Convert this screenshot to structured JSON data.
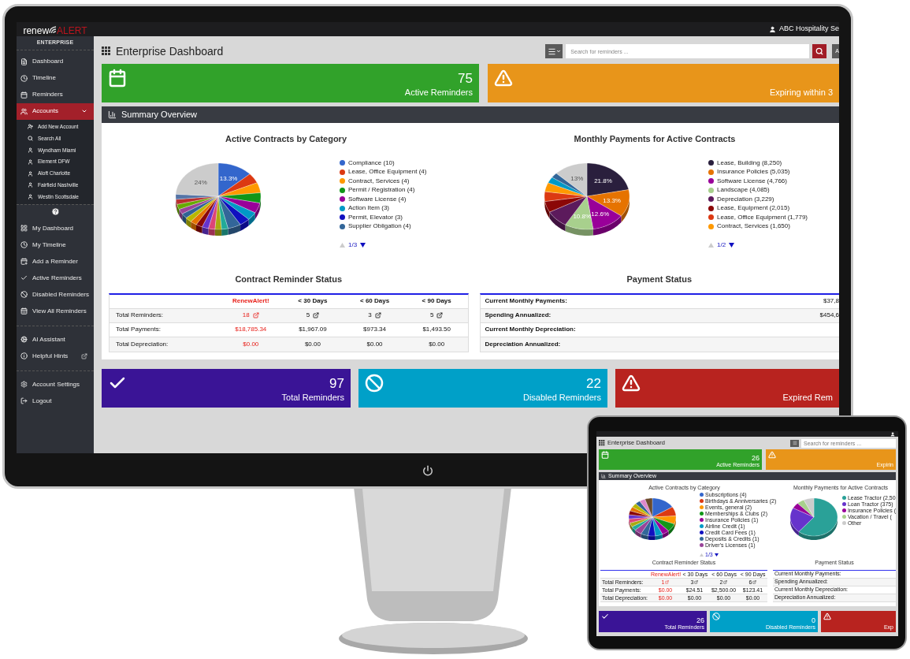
{
  "monitor": {
    "top_bar": {
      "logo_first": "renew",
      "logo_second": "ALERT",
      "account": "ABC Hospitality Se"
    },
    "sidebar": {
      "edition": "ENTERPRISE",
      "sections": [
        {
          "items": [
            {
              "label": "Dashboard",
              "selected": false,
              "expanded": false
            },
            {
              "label": "Timeline",
              "selected": false,
              "expanded": false
            },
            {
              "label": "Reminders",
              "selected": false,
              "expanded": false
            },
            {
              "label": "Accounts",
              "selected": true,
              "expanded": true,
              "children": [
                {
                  "label": "Add New Account"
                },
                {
                  "label": "Search All"
                },
                {
                  "label": "Wyndham Miami"
                },
                {
                  "label": "Element DFW"
                },
                {
                  "label": "Aloft Charlotte"
                },
                {
                  "label": "Fairfield Nashville"
                },
                {
                  "label": "Westin Scottsdale"
                }
              ]
            }
          ]
        },
        {
          "items": [
            {
              "label": "My Dashboard",
              "selected": false
            },
            {
              "label": "My Timeline",
              "selected": false
            },
            {
              "label": "Add a Reminder",
              "selected": false
            },
            {
              "label": "Active Reminders",
              "selected": false
            },
            {
              "label": "Disabled Reminders",
              "selected": false
            },
            {
              "label": "View All Reminders",
              "selected": false
            }
          ]
        },
        {
          "items": [
            {
              "label": "AI Assistant",
              "selected": false
            },
            {
              "label": "Helpful Hints",
              "selected": false
            }
          ]
        },
        {
          "items": [
            {
              "label": "Account Settings",
              "selected": false
            },
            {
              "label": "Logout",
              "selected": false
            }
          ]
        }
      ]
    },
    "dashboard": {
      "title": "Enterprise Dashboard",
      "search": {
        "placeholder": "Search for reminders ...",
        "button_visible": true
      },
      "extra_button": "A",
      "top_cards": [
        {
          "value": "75",
          "label": "Active Reminders",
          "color": "#31a22a"
        },
        {
          "label": "Expiring within 3",
          "color": "#e8951a"
        }
      ],
      "summary": {
        "title": "Summary Overview",
        "charts": [
          {
            "title": "Active Contracts by Category",
            "slice_labels": [
              "13.3%",
              "24%"
            ],
            "pager": "1/3",
            "legend": [
              {
                "label": "Compliance (10)",
                "color": "#3366cc"
              },
              {
                "label": "Lease, Office Equipment (4)",
                "color": "#dc3912"
              },
              {
                "label": "Contract, Services (4)",
                "color": "#ff9900"
              },
              {
                "label": "Permit / Registration (4)",
                "color": "#109618"
              },
              {
                "label": "Software License (4)",
                "color": "#990099"
              },
              {
                "label": "Action Item (3)",
                "color": "#0099c6"
              },
              {
                "label": "Permit, Elevator (3)",
                "color": "#1010c0"
              },
              {
                "label": "Supplier Obligation (4)",
                "color": "#336699"
              }
            ]
          },
          {
            "title": "Monthly Payments for Active Contracts",
            "slice_labels": [
              "21.8%",
              "13.3%",
              "12.6%",
              "10.8%",
              "13%"
            ],
            "pager": "1/2",
            "legend": [
              {
                "label": "Lease, Building (8,250)",
                "color": "#2a1f3d"
              },
              {
                "label": "Insurance Policies (5,035)",
                "color": "#e67300"
              },
              {
                "label": "Software License (4,766)",
                "color": "#990099"
              },
              {
                "label": "Landscape (4,085)",
                "color": "#a8d08d"
              },
              {
                "label": "Depreciation (3,229)",
                "color": "#5c1a5c"
              },
              {
                "label": "Lease, Equipment (2,015)",
                "color": "#8b0707"
              },
              {
                "label": "Lease, Office Equipment (1,779)",
                "color": "#dc3912"
              },
              {
                "label": "Contract, Services (1,650)",
                "color": "#ff9900"
              }
            ]
          }
        ],
        "reminder_table": {
          "title": "Contract Reminder Status",
          "columns": [
            "RenewAlert!",
            "< 30 Days",
            "< 60 Days",
            "< 90 Days"
          ],
          "rows": [
            {
              "label": "Total Reminders:",
              "kind": "link",
              "cells": [
                "18",
                "5",
                "3",
                "5"
              ]
            },
            {
              "label": "Total Payments:",
              "kind": "plain",
              "cells": [
                "$18,785.34",
                "$1,967.09",
                "$973.34",
                "$1,493.50"
              ]
            },
            {
              "label": "Total Depreciation:",
              "kind": "plain",
              "cells": [
                "$0.00",
                "$0.00",
                "$0.00",
                "$0.00"
              ]
            }
          ]
        },
        "payment_table": {
          "title": "Payment Status",
          "rows": [
            {
              "label": "Current Monthly Payments:",
              "value": "$37,8"
            },
            {
              "label": "Spending Annualized:",
              "value": "$454,6"
            },
            {
              "label": "Current Monthly Depreciation:"
            },
            {
              "label": "Depreciation Annualized:"
            }
          ]
        }
      },
      "bottom_cards": [
        {
          "value": "97",
          "label": "Total Reminders",
          "color": "#3a1496"
        },
        {
          "value": "22",
          "label": "Disabled Reminders",
          "color": "#00a0c8"
        },
        {
          "label": "Expired Rem",
          "color": "#b8231f"
        }
      ]
    }
  },
  "tablet": {
    "dashboard": {
      "title": "Enterprise Dashboard",
      "search": {
        "placeholder": "Search for reminders ..."
      },
      "top_cards": [
        {
          "value": "26",
          "label": "Active Reminders",
          "color": "#31a22a"
        },
        {
          "label": "Expirin",
          "color": "#e8951a"
        }
      ],
      "summary": {
        "title": "Summary Overview",
        "charts": [
          {
            "title": "Active Contracts by Category",
            "pager": "1/3",
            "legend": [
              {
                "label": "Subscriptions (4)",
                "color": "#3366cc"
              },
              {
                "label": "Birthdays & Anniversaries (2)",
                "color": "#dc3912"
              },
              {
                "label": "Events, general (2)",
                "color": "#ff9900"
              },
              {
                "label": "Memberships & Clubs (2)",
                "color": "#109618"
              },
              {
                "label": "Insurance Policies (1)",
                "color": "#990099"
              },
              {
                "label": "Airline Credit (1)",
                "color": "#0099c6"
              },
              {
                "label": "Credit Card Fees (1)",
                "color": "#1010c0"
              },
              {
                "label": "Deposits & Credits (1)",
                "color": "#336699"
              },
              {
                "label": "Driver's Licenses (1)",
                "color": "#994499"
              }
            ]
          },
          {
            "title": "Monthly Payments for Active Contracts",
            "legend": [
              {
                "label": "Lease Tractor (2,50",
                "color": "#2aa198"
              },
              {
                "label": "Loan Tractor (375)",
                "color": "#6633cc"
              },
              {
                "label": "Insurance Policies (",
                "color": "#990099"
              },
              {
                "label": "Vacation / Travel (",
                "color": "#a8d08d"
              },
              {
                "label": "Other",
                "color": "#cccccc"
              }
            ]
          }
        ],
        "reminder_table": {
          "title": "Contract Reminder Status",
          "columns": [
            "RenewAlert!",
            "< 30 Days",
            "< 60 Days",
            "< 90 Days"
          ],
          "rows": [
            {
              "label": "Total Reminders:",
              "kind": "link",
              "cells": [
                "1",
                "3",
                "2",
                "6"
              ]
            },
            {
              "label": "Total Payments:",
              "kind": "plain",
              "cells": [
                "$0.00",
                "$24.51",
                "$2,500.00",
                "$123.41"
              ]
            },
            {
              "label": "Total Depreciation:",
              "kind": "plain",
              "cells": [
                "$0.00",
                "$0.00",
                "$0.00",
                "$0.00"
              ]
            }
          ]
        },
        "payment_table": {
          "title": "Payment Status",
          "rows": [
            {
              "label": "Current Monthly Payments:"
            },
            {
              "label": "Spending Annualized:"
            },
            {
              "label": "Current Monthly Depreciation:"
            },
            {
              "label": "Depreciation Annualized:"
            }
          ]
        }
      },
      "bottom_cards": [
        {
          "value": "26",
          "label": "Total Reminders",
          "color": "#3a1496"
        },
        {
          "value": "0",
          "label": "Disabled Reminders",
          "color": "#00a0c8"
        },
        {
          "label": "Exp",
          "color": "#b8231f"
        }
      ]
    }
  }
}
